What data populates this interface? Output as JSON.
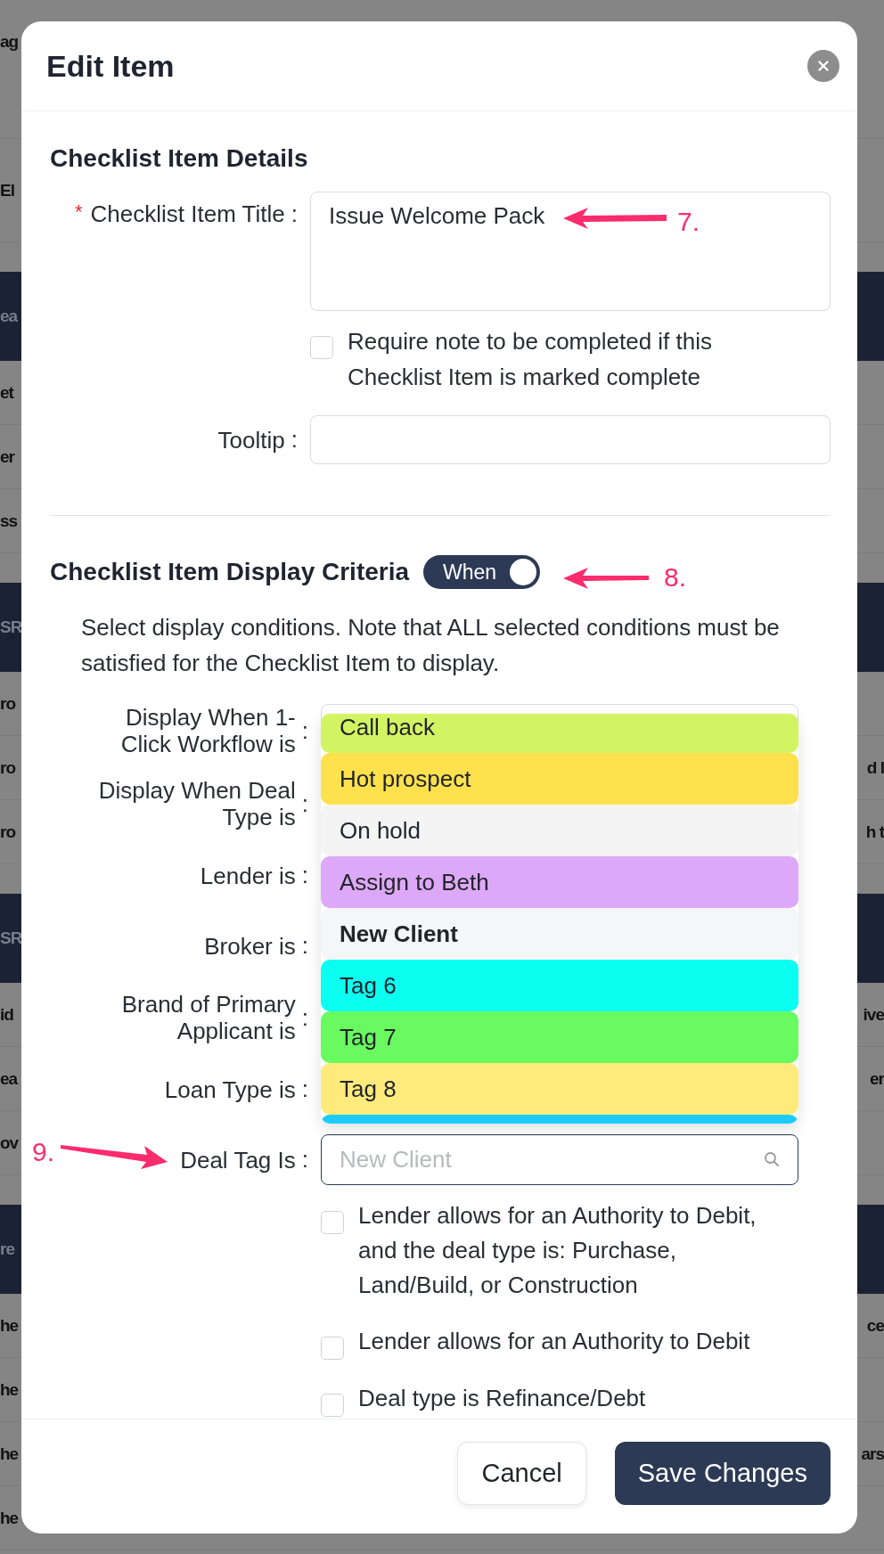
{
  "background_rows": [
    {
      "kind": "top",
      "left": "ag"
    },
    {
      "kind": "head",
      "left": "El"
    },
    {
      "kind": "band",
      "left": "ea"
    },
    {
      "kind": "row",
      "left": "et"
    },
    {
      "kind": "row",
      "left": "er"
    },
    {
      "kind": "row",
      "left": "ss"
    },
    {
      "kind": "band",
      "left": "SR"
    },
    {
      "kind": "row",
      "left": "ro"
    },
    {
      "kind": "row",
      "left": "ro",
      "right": "d l"
    },
    {
      "kind": "row",
      "left": "ro",
      "right": "h t"
    },
    {
      "kind": "band",
      "left": "SR"
    },
    {
      "kind": "row",
      "left": "id",
      "right": "ive"
    },
    {
      "kind": "row",
      "left": "ea",
      "right": "er"
    },
    {
      "kind": "row",
      "left": "ov"
    },
    {
      "kind": "band",
      "left": "re"
    },
    {
      "kind": "row",
      "left": "he",
      "right": "ce"
    },
    {
      "kind": "row",
      "left": "he"
    },
    {
      "kind": "row",
      "left": "he",
      "right": "ars"
    },
    {
      "kind": "row",
      "left": "he"
    }
  ],
  "modal": {
    "title": "Edit Item",
    "details": {
      "heading": "Checklist Item Details",
      "title_field": {
        "required_mark": "*",
        "label": "Checklist Item Title",
        "colon": ":",
        "value": "Issue Welcome Pack"
      },
      "require_note": {
        "label": "Require note to be completed if this Checklist Item is marked complete",
        "checked": false
      },
      "tooltip": {
        "label": "Tooltip",
        "colon": ":"
      }
    },
    "criteria": {
      "heading": "Checklist Item Display Criteria",
      "toggle": {
        "label": "When",
        "on": true
      },
      "description": "Select display conditions. Note that ALL selected conditions must be satisfied for the Checklist Item to display.",
      "fields": [
        {
          "label": "Display When 1-Click Workflow is",
          "colon": ":",
          "kind": "select"
        },
        {
          "label": "Display When Deal Type is",
          "colon": ":",
          "kind": "covered"
        },
        {
          "label": "Lender is",
          "colon": ":",
          "kind": "covered"
        },
        {
          "label": "Broker is",
          "colon": ":",
          "kind": "covered"
        },
        {
          "label": "Brand of Primary Applicant is",
          "colon": ":",
          "kind": "covered"
        },
        {
          "label": "Loan Type is",
          "colon": ":",
          "kind": "covered"
        },
        {
          "label": "Deal Tag Is",
          "colon": ":",
          "kind": "search",
          "placeholder": "New Client"
        }
      ],
      "dropdown": {
        "options": [
          {
            "label": "Call back",
            "color": "#d3f462",
            "selected": false
          },
          {
            "label": "Hot prospect",
            "color": "#ffe14d",
            "selected": false
          },
          {
            "label": "On hold",
            "color": "#f4f4f5",
            "selected": false
          },
          {
            "label": "Assign to Beth",
            "color": "#dea8f8",
            "selected": false
          },
          {
            "label": "New Client",
            "color": "#f5f6f8",
            "selected": true
          },
          {
            "label": "Tag 6",
            "color": "#0bfff1",
            "selected": false
          },
          {
            "label": "Tag 7",
            "color": "#69fa60",
            "selected": false
          },
          {
            "label": "Tag 8",
            "color": "#ffeb7c",
            "selected": false
          }
        ],
        "next_option": {
          "color": "#1ecbff"
        }
      },
      "options": [
        {
          "label": "Lender allows for an Authority to Debit, and the deal type is: Purchase, Land/Build, or Construction",
          "checked": false
        },
        {
          "label": "Lender allows for an Authority to Debit",
          "checked": false
        },
        {
          "label": "Deal type is Refinance/Debt",
          "checked": false
        }
      ]
    },
    "footer": {
      "buttons": [
        {
          "label": "Cancel",
          "kind": "secondary"
        },
        {
          "label": "Save Changes",
          "kind": "primary"
        }
      ]
    }
  },
  "annotations": [
    {
      "text": "7."
    },
    {
      "text": "8."
    },
    {
      "text": "9."
    }
  ]
}
